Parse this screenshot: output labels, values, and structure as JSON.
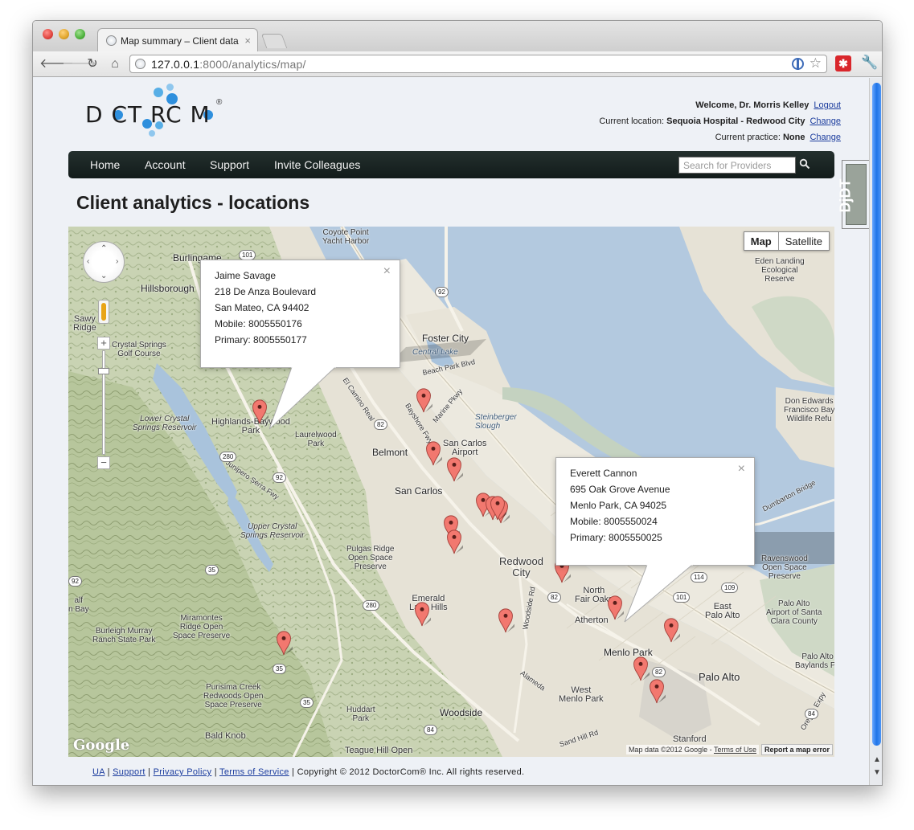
{
  "browser": {
    "tab_title": "Map summary – Client data",
    "url_host": "127.0.0.1",
    "url_rest": ":8000/analytics/map/"
  },
  "logo": {
    "text": "D CT RC M",
    "reg": "®"
  },
  "header": {
    "welcome_prefix": "Welcome,",
    "user_name": "Dr. Morris Kelley",
    "logout": "Logout",
    "location_label": "Current location:",
    "location_value": "Sequoia Hospital - Redwood City",
    "location_change": "Change",
    "practice_label": "Current practice:",
    "practice_value": "None",
    "practice_change": "Change"
  },
  "djdt": {
    "label": "DjDT"
  },
  "nav": {
    "items": [
      "Home",
      "Account",
      "Support",
      "Invite Colleagues"
    ],
    "search_placeholder": "Search for Providers"
  },
  "page": {
    "title": "Client analytics - locations"
  },
  "map": {
    "map_type": {
      "map": "Map",
      "satellite": "Satellite"
    },
    "labels": {
      "coyote": "Coyote Point\nYacht Harbor",
      "burlingame": "Burlingame",
      "hillsborough": "Hillsborough",
      "fostercity": "Foster City",
      "centrallake": "Central Lake",
      "beachpark": "Beach Park Blvd",
      "belmont": "Belmont",
      "sancarlos": "San Carlos",
      "sancarlosairport": "San Carlos\nAirport",
      "steinberger": "Steinberger\nSlough",
      "redwoodcity": "Redwood\nCity",
      "northfairoaks": "North\nFair Oaks",
      "atherton": "Atherton",
      "menlopark": "Menlo Park",
      "paloalto": "Palo Alto",
      "eastpaloalto": "East\nPalo Alto",
      "westmenlo": "West\nMenlo Park",
      "woodside": "Woodside",
      "stanford": "Stanford",
      "emerald": "Emerald\nLake Hills",
      "highlands": "Highlands-Baywood\nPark",
      "laurelwood": "Laurelwood\nPark",
      "crystalsprings": "Crystal Springs\nGolf Course",
      "lowercrystal": "Lower Crystal\nSprings Reservoir",
      "uppercrystal": "Upper Crystal\nSprings Reservoir",
      "pulgas": "Pulgas Ridge\nOpen Space\nPreserve",
      "burleigh": "Burleigh Murray\nRanch State Park",
      "miramontes": "Miramontes\nRidge Open\nSpace Preserve",
      "purisima": "Purisima Creek\nRedwoods Open\nSpace Preserve",
      "baldknob": "Bald Knob",
      "huddart": "Huddart\nPark",
      "teague": "Teague Hill Open",
      "edenlanding": "Eden Landing\nEcological\nReserve",
      "donedwards": "Don Edwards\nFrancisco Bay\nWildlife Refu",
      "ravenswood": "Ravenswood\nOpen Space\nPreserve",
      "paloaltoairport": "Palo Alto\nAirport of Santa\nClara County",
      "paloaltobaylands": "Palo Alto\nBaylands Pa",
      "dumbarton": "Dumbarton Bridge",
      "halfmoon": "alf\nn Bay",
      "sawyer": "Sawy\nRidge",
      "elcamino": "El Camino Real",
      "bayshore": "Bayshore Fwy",
      "junipero": "Junipero Serra Fwy",
      "alameda": "Alameda",
      "woodsiderd": "Woodside Rd",
      "sandhill": "Sand Hill Rd",
      "oregon": "Oregon Expy",
      "marine": "Marine Pkwy"
    },
    "shields": [
      "101",
      "92",
      "82",
      "280",
      "92",
      "35",
      "280",
      "84",
      "35",
      "35",
      "84",
      "82",
      "114",
      "109",
      "101",
      "82",
      "92"
    ],
    "infowindows": [
      {
        "name": "Jaime Savage",
        "address": "218 De Anza Boulevard",
        "city": "San Mateo, CA 94402",
        "mobile": "Mobile: 8005550176",
        "primary": "Primary: 8005550177"
      },
      {
        "name": "Everett Cannon",
        "address": "695 Oak Grove Avenue",
        "city": "Menlo Park, CA 94025",
        "mobile": "Mobile: 8005550024",
        "primary": "Primary: 8005550025"
      }
    ],
    "close_glyph": "×",
    "attribution": "Map data ©2012 Google - ",
    "terms": "Terms of Use",
    "report": "Report a map error",
    "google": "Google"
  },
  "footer": {
    "links": [
      "UA",
      "Support",
      "Privacy Policy",
      "Terms of Service"
    ],
    "copyright": " | Copyright © 2012 DoctorCom® Inc. All rights reserved.",
    "sep": " | "
  },
  "colors": {
    "nav_bg": "#1a2423",
    "link": "#1c3d9e",
    "marker": "#f2786f",
    "water": "#b9cfe4",
    "land": "#e9e6dd"
  }
}
